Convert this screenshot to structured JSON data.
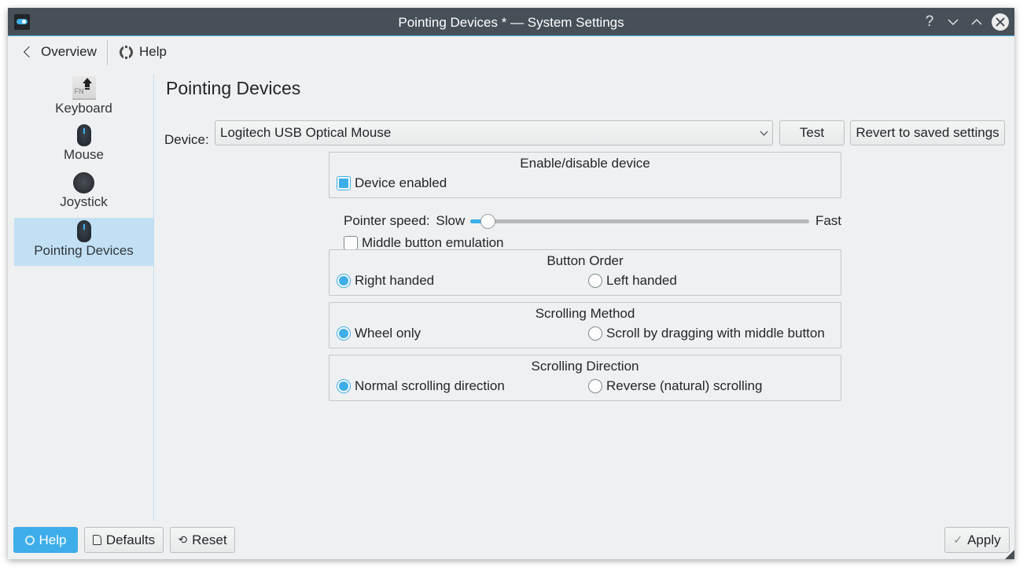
{
  "window": {
    "title": "Pointing Devices * — System Settings",
    "controls": {
      "help": "?",
      "minimize": "⌄",
      "maximize": "⌃",
      "close": "✕"
    }
  },
  "nav": {
    "overview_label": "Overview",
    "help_label": "Help"
  },
  "sidebar": {
    "items": [
      {
        "label": "Keyboard",
        "icon": "keyboard-icon",
        "active": false
      },
      {
        "label": "Mouse",
        "icon": "mouse-icon",
        "active": false
      },
      {
        "label": "Joystick",
        "icon": "joystick-icon",
        "active": false
      },
      {
        "label": "Pointing Devices",
        "icon": "mouse-icon",
        "active": true
      }
    ],
    "keyboard_fn_text": "FN"
  },
  "main": {
    "title": "Pointing Devices",
    "device_label": "Device:",
    "device_value": "Logitech USB Optical Mouse",
    "test_label": "Test",
    "revert_label": "Revert to saved settings",
    "enable_group": {
      "title": "Enable/disable device",
      "device_enabled_label": "Device enabled",
      "device_enabled": true
    },
    "pointer_speed": {
      "label": "Pointer speed:",
      "min_label": "Slow",
      "max_label": "Fast",
      "value_fraction": 0.05
    },
    "middle_emulation": {
      "label": "Middle button emulation",
      "checked": false
    },
    "button_order": {
      "title": "Button Order",
      "options": [
        {
          "label": "Right handed",
          "selected": true
        },
        {
          "label": "Left handed",
          "selected": false
        }
      ]
    },
    "scrolling_method": {
      "title": "Scrolling Method",
      "options": [
        {
          "label": "Wheel only",
          "selected": true
        },
        {
          "label": "Scroll by dragging with middle button",
          "selected": false
        }
      ]
    },
    "scrolling_direction": {
      "title": "Scrolling Direction",
      "options": [
        {
          "label": "Normal scrolling direction",
          "selected": true
        },
        {
          "label": "Reverse (natural) scrolling",
          "selected": false
        }
      ]
    }
  },
  "footer": {
    "help_label": "Help",
    "defaults_label": "Defaults",
    "reset_label": "Reset",
    "apply_label": "Apply"
  },
  "colors": {
    "accent": "#3daee9",
    "titlebar": "#475057",
    "window_bg": "#eff0f1",
    "sidebar_selected": "#c2e0f4"
  }
}
